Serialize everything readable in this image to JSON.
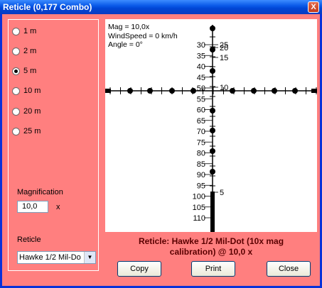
{
  "window": {
    "title": "Reticle (0,177 Combo)",
    "close_glyph": "X"
  },
  "distances": {
    "items": [
      "1 m",
      "2 m",
      "5 m",
      "10 m",
      "20 m",
      "25 m"
    ],
    "selected": "5 m"
  },
  "magnification": {
    "label": "Magnification",
    "value": "10,0",
    "unit": "x"
  },
  "reticle_select": {
    "label": "Reticle",
    "value": "Hawke 1/2 Mil-Do"
  },
  "stats": {
    "mag": "Mag = 10,0x",
    "wind": "WindSpeed = 0 km/h",
    "angle": "Angle = 0°"
  },
  "scale": {
    "left_labels": [
      "30",
      "35",
      "40",
      "45",
      "50",
      "55",
      "60",
      "65",
      "70",
      "75",
      "80",
      "85",
      "90",
      "95",
      "100",
      "105",
      "110"
    ],
    "right_labels": [
      "25",
      "20",
      "15",
      "10",
      "5"
    ]
  },
  "caption": {
    "line1": "Reticle: Hawke 1/2 Mil-Dot (10x mag",
    "line2": "calibration) @ 10,0 x"
  },
  "buttons": {
    "copy": "Copy",
    "print": "Print",
    "close": "Close"
  },
  "colors": {
    "background": "#ff7f7f",
    "title_bar": "#0054e3",
    "caption_text": "#5a0000"
  }
}
